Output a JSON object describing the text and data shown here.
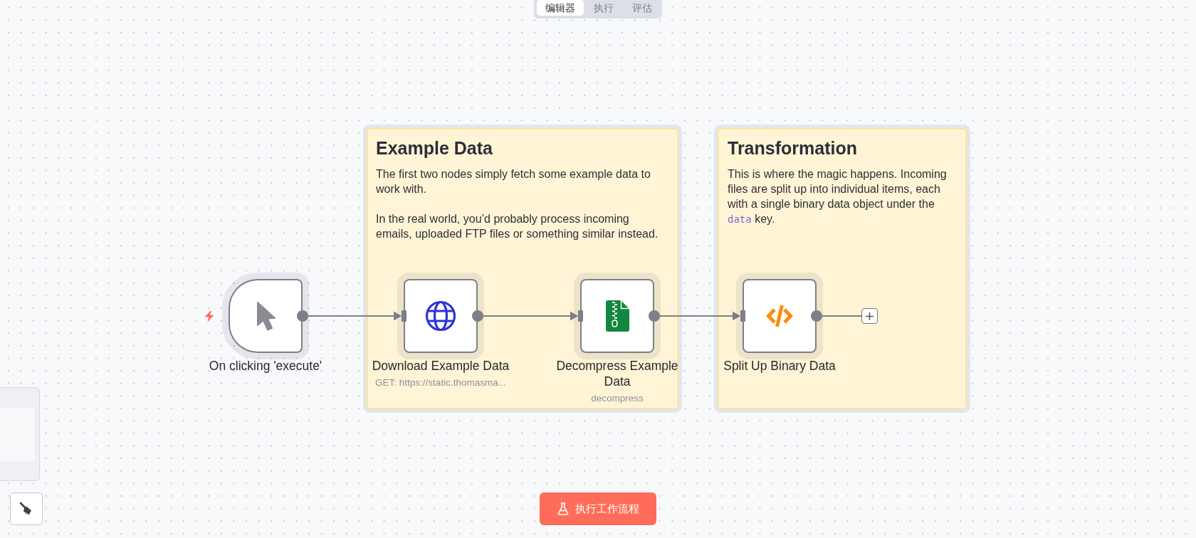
{
  "tabs": [
    {
      "label": "编辑器",
      "selected": true
    },
    {
      "label": "执行",
      "selected": false
    },
    {
      "label": "评估",
      "selected": false
    }
  ],
  "sticky_notes": [
    {
      "title": "Example Data",
      "paragraphs": [
        [
          {
            "kind": "text",
            "text": "The first two nodes simply fetch some example data to work with."
          }
        ],
        [
          {
            "kind": "text",
            "text": "In the real world, you’d probably process incoming emails, uploaded FTP files or something similar instead."
          }
        ]
      ]
    },
    {
      "title": "Transformation",
      "paragraphs": [
        [
          {
            "kind": "text",
            "text": "This is where the magic happens. Incoming files are split up into individual items, each with a single binary data object under the "
          },
          {
            "kind": "code",
            "text": "data"
          },
          {
            "kind": "text",
            "text": " key."
          }
        ]
      ]
    }
  ],
  "nodes": [
    {
      "kind": "trigger",
      "name": "On clicking 'execute'"
    },
    {
      "kind": "http",
      "name": "Download Example Data",
      "subtitle": "GET: https://static.thomasma..."
    },
    {
      "kind": "compression",
      "name": "Decompress Example Data",
      "subtitle": "decompress"
    },
    {
      "kind": "code",
      "name": "Split Up Binary Data"
    }
  ],
  "execute_button": {
    "label": "执行工作流程"
  }
}
